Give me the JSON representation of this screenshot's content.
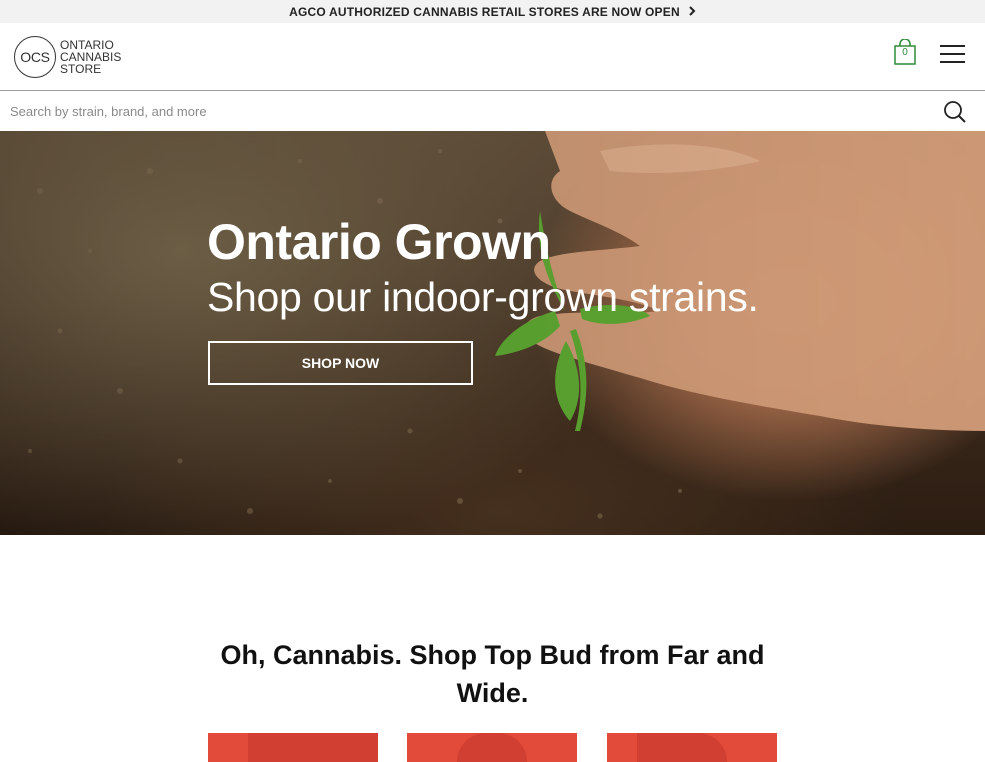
{
  "announcement": {
    "text": "AGCO AUTHORIZED CANNABIS RETAIL STORES ARE NOW OPEN",
    "chevron": "chevron-right-icon"
  },
  "logo": {
    "mark": "OCS",
    "line1": "ONTARIO",
    "line2": "CANNABIS",
    "line3": "STORE"
  },
  "cart": {
    "count": "0",
    "icon": "shopping-bag-icon",
    "color": "#2e8b3a"
  },
  "menu": {
    "icon": "hamburger-menu-icon"
  },
  "search": {
    "placeholder": "Search by strain, brand, and more",
    "value": "",
    "icon": "search-icon"
  },
  "hero": {
    "title": "Ontario Grown",
    "subtitle": "Shop our indoor-grown strains.",
    "cta_label": "SHOP NOW"
  },
  "section": {
    "title": "Oh, Cannabis. Shop Top Bud from Far and Wide."
  },
  "colors": {
    "accent_red": "#e24a3a",
    "topbar_bg": "#f2f2f2"
  }
}
